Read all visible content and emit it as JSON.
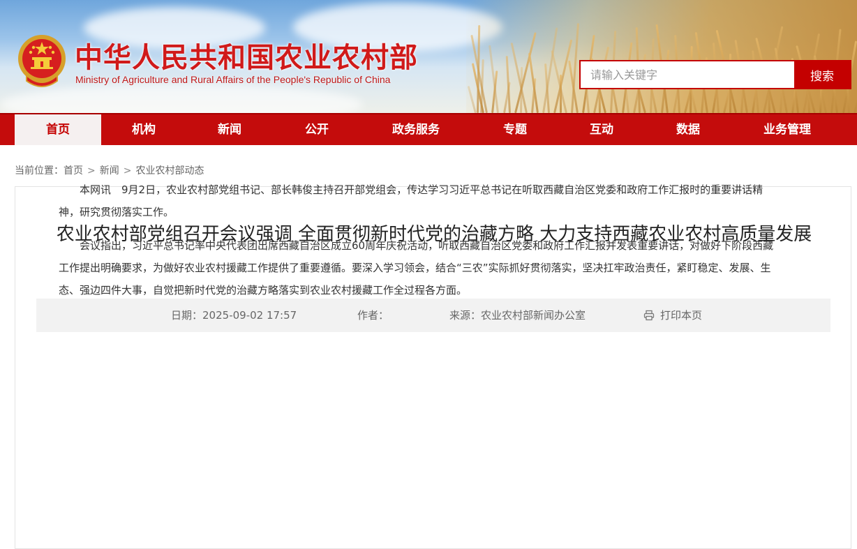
{
  "header": {
    "title_cn": "中华人民共和国农业农村部",
    "title_en": "Ministry of Agriculture and Rural Affairs of the People's Republic of China",
    "emblem_icon": "national-emblem-icon"
  },
  "search": {
    "placeholder": "请输入关键字",
    "button_label": "搜索"
  },
  "nav": {
    "items": [
      {
        "label": "首页",
        "active": true
      },
      {
        "label": "机构"
      },
      {
        "label": "新闻"
      },
      {
        "label": "公开"
      },
      {
        "label": "政务服务"
      },
      {
        "label": "专题"
      },
      {
        "label": "互动"
      },
      {
        "label": "数据"
      },
      {
        "label": "业务管理"
      }
    ]
  },
  "breadcrumb": {
    "prefix": "当前位置：",
    "items": [
      "首页",
      "新闻",
      "农业农村部动态"
    ],
    "separator": ">"
  },
  "article": {
    "title": "农业农村部党组召开会议强调 全面贯彻新时代党的治藏方略 大力支持西藏农业农村高质量发展",
    "meta": {
      "date_label": "日期：",
      "date_value": "2025-09-02 17:57",
      "author_label": "作者：",
      "source_label": "来源：",
      "source_value": "农业农村部新闻办公室",
      "print_label": "打印本页",
      "print_icon": "printer-icon"
    },
    "paragraphs": [
      "本网讯　9月2日，农业农村部党组书记、部长韩俊主持召开部党组会，传达学习习近平总书记在听取西藏自治区党委和政府工作汇报时的重要讲话精神，研究贯彻落实工作。",
      "会议指出，习近平总书记率中央代表团出席西藏自治区成立60周年庆祝活动，听取西藏自治区党委和政府工作汇报并发表重要讲话，对做好下阶段西藏工作提出明确要求，为做好农业农村援藏工作提供了重要遵循。要深入学习领会，结合“三农”实际抓好贯彻落实，坚决扛牢政治责任，紧盯稳定、发展、生态、强边四件大事，自觉把新时代党的治藏方略落实到农业农村援藏工作全过程各方面。"
    ]
  },
  "colors": {
    "brand_red": "#c40c0c",
    "title_red": "#d01a1a"
  }
}
